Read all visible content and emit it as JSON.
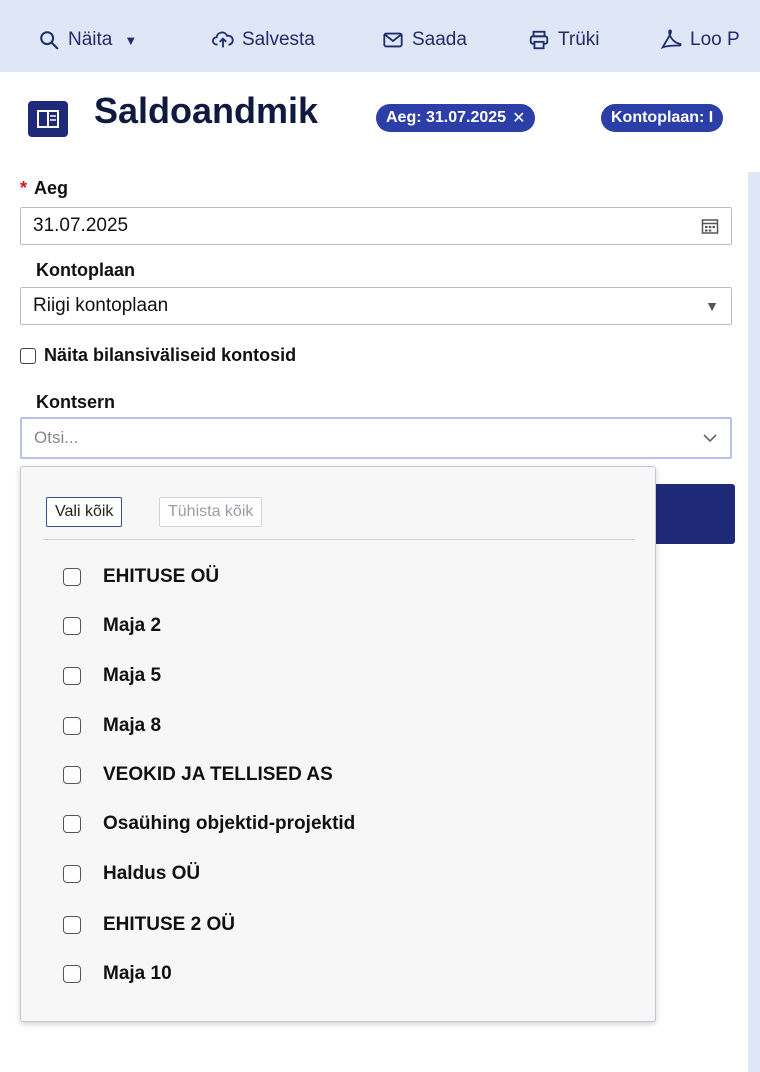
{
  "toolbar": {
    "items": [
      {
        "label": "Näita",
        "icon": "search-icon"
      },
      {
        "label": "Salvesta",
        "icon": "cloud-upload-icon"
      },
      {
        "label": "Saada",
        "icon": "mail-icon"
      },
      {
        "label": "Trüki",
        "icon": "printer-icon"
      },
      {
        "label": "Loo P",
        "icon": "pdf-icon"
      }
    ]
  },
  "header": {
    "title": "Saldoandmik",
    "badges": [
      {
        "text": "Aeg: 31.07.2025"
      },
      {
        "text": "Kontoplaan: I"
      }
    ]
  },
  "form": {
    "required_mark": "*",
    "aeg": {
      "label": "Aeg",
      "value": "31.07.2025"
    },
    "kontoplaan": {
      "label": "Kontoplaan",
      "value": "Riigi kontoplaan"
    },
    "bilans": {
      "label": "Näita bilansiväliseid kontosid",
      "checked": false
    },
    "kontsern": {
      "label": "Kontsern",
      "placeholder": "Otsi..."
    }
  },
  "dropdown": {
    "select_all": "Vali kõik",
    "clear_all": "Tühista kõik",
    "options": [
      "EHITUSE OÜ",
      "Maja 2",
      "Maja 5",
      "Maja 8",
      "VEOKID JA TELLISED AS",
      "Osaühing objektid-projektid",
      "Haldus OÜ",
      "EHITUSE 2 OÜ",
      "Maja 10"
    ]
  },
  "colors": {
    "toolbar_bg": "#dfe6f6",
    "accent": "#1e2a78",
    "badge": "#2c3fa8",
    "required": "#dd1122"
  }
}
